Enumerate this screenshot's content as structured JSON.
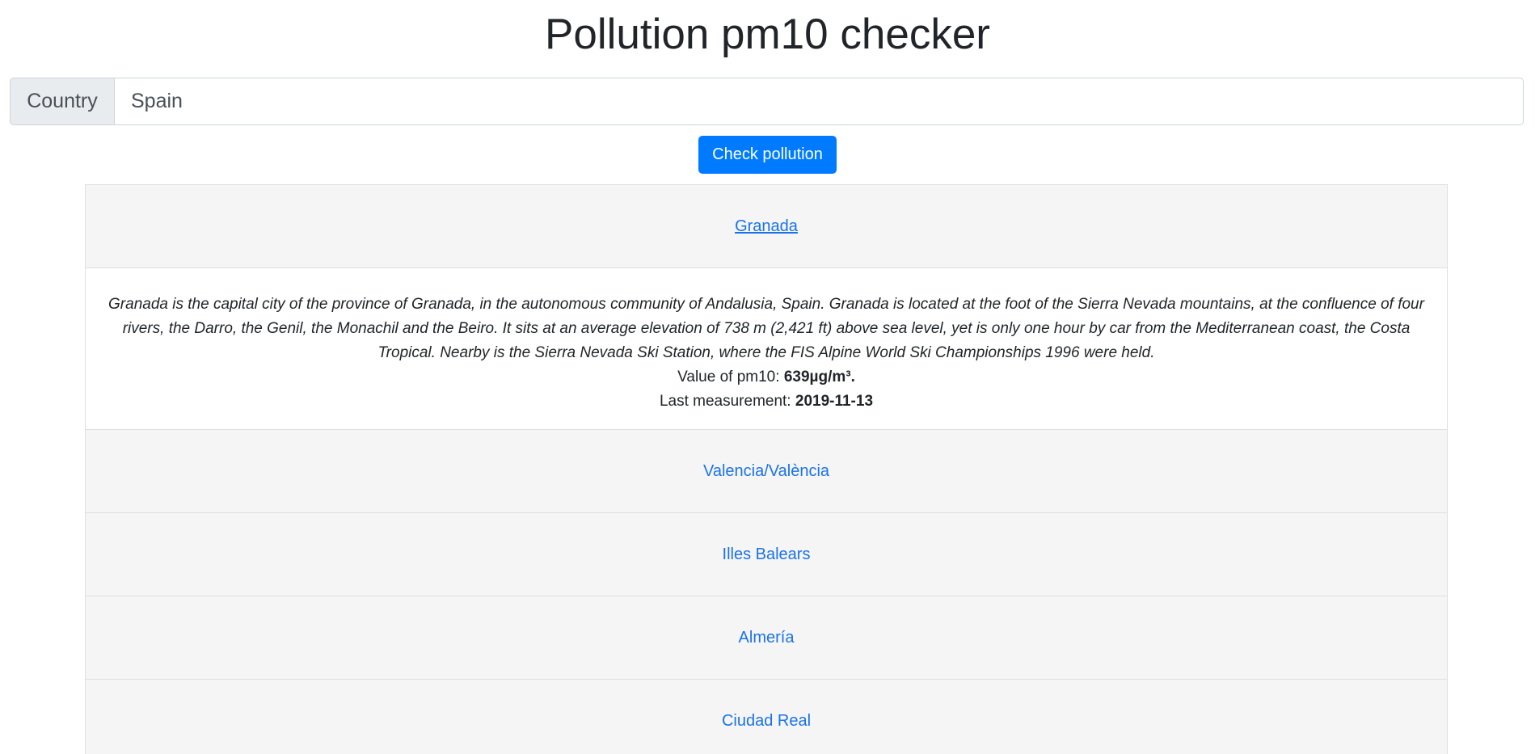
{
  "header": {
    "title": "Pollution pm10 checker"
  },
  "search": {
    "prefix_label": "Country",
    "value": "Spain"
  },
  "actions": {
    "check_label": "Check pollution"
  },
  "cities": [
    {
      "name": "Granada",
      "expanded": true,
      "description": "Granada is the capital city of the province of Granada, in the autonomous community of Andalusia, Spain. Granada is located at the foot of the Sierra Nevada mountains, at the confluence of four rivers, the Darro, the Genil, the Monachil and the Beiro. It sits at an average elevation of 738 m (2,421 ft) above sea level, yet is only one hour by car from the Mediterranean coast, the Costa Tropical. Nearby is the Sierra Nevada Ski Station, where the FIS Alpine World Ski Championships 1996 were held.",
      "pm10_label": "Value of pm10: ",
      "pm10_value": "639µg/m³.",
      "measurement_label": "Last measurement: ",
      "measurement_date": "2019-11-13"
    },
    {
      "name": "Valencia/València"
    },
    {
      "name": "Illes Balears"
    },
    {
      "name": "Almería"
    },
    {
      "name": "Ciudad Real"
    }
  ],
  "colors": {
    "primary_button": "#007bff",
    "link": "#1a73e8",
    "panel_header_bg": "#f5f5f5"
  }
}
